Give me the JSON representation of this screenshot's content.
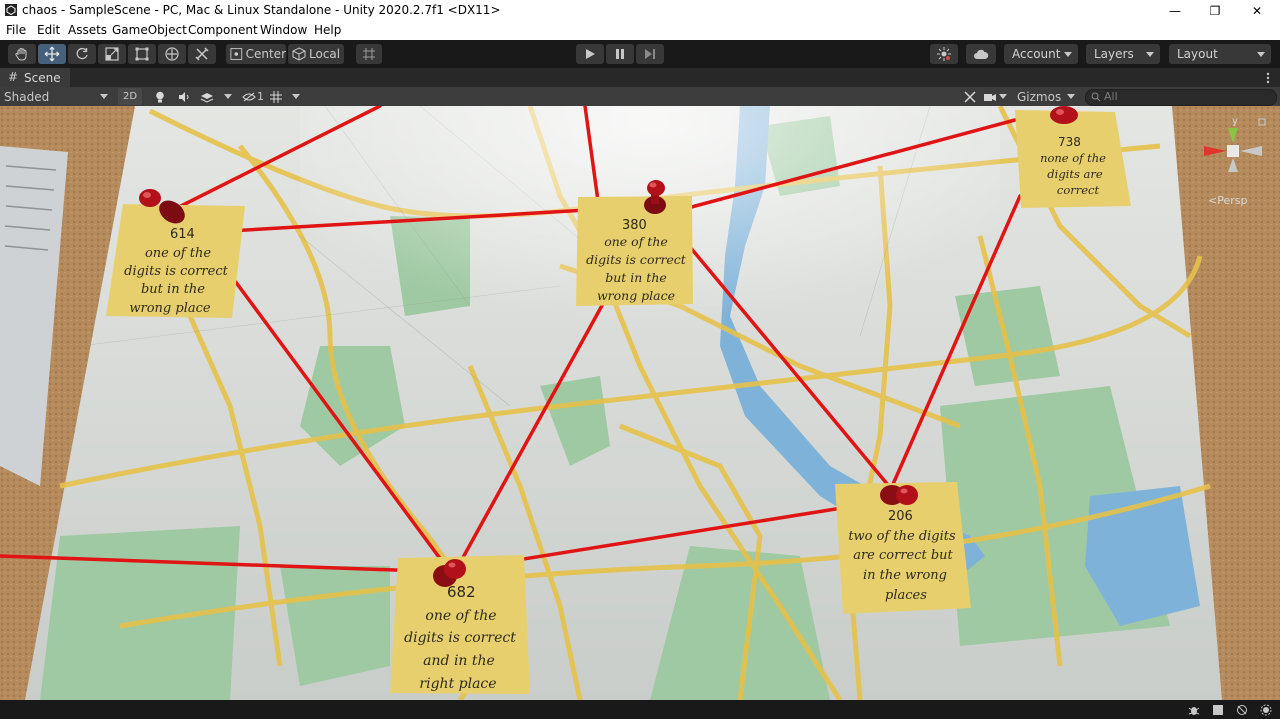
{
  "window": {
    "title": "chaos - SampleScene - PC, Mac & Linux Standalone - Unity 2020.2.7f1 <DX11>",
    "controls": [
      "—",
      "❐",
      "✕"
    ]
  },
  "menu": [
    "File",
    "Edit",
    "Assets",
    "GameObject",
    "Component",
    "Window",
    "Help"
  ],
  "toolbar": {
    "pivot_label": "Center",
    "space_label": "Local",
    "account_label": "Account",
    "layers_label": "Layers",
    "layout_label": "Layout"
  },
  "scene_tab": {
    "label": "Scene"
  },
  "scene_toolbar": {
    "draw_mode": "Shaded",
    "two_d_label": "2D",
    "hidden_count": "1",
    "gizmos_label": "Gizmos",
    "search_placeholder": "All"
  },
  "gizmo": {
    "axis_y": "y",
    "persp_label": "<Persp"
  },
  "notes": [
    {
      "number": "614",
      "lines": [
        "one of the",
        "digits is correct",
        "but in the",
        "wrong place"
      ]
    },
    {
      "number": "380",
      "lines": [
        "one of the",
        "digits is correct",
        "but in the",
        "wrong place"
      ]
    },
    {
      "number": "738",
      "lines": [
        "none of the",
        "digits are",
        "correct"
      ]
    },
    {
      "number": "206",
      "lines": [
        "two of the digits",
        "are correct but",
        "in the wrong",
        "places"
      ]
    },
    {
      "number": "682",
      "lines": [
        "one of the",
        "digits is correct",
        "and in the",
        "right place"
      ]
    }
  ],
  "colors": {
    "string_red": "#e01414",
    "note_yellow": "#e8cf6e",
    "pin_red": "#b3111a",
    "cork": "#b58a5c",
    "map_bg": "#dcdedb",
    "road_yellow": "#e6c14a",
    "park_green": "#9fc9a2",
    "water_blue": "#7fb2d8",
    "selected_tool": "#46607c"
  }
}
